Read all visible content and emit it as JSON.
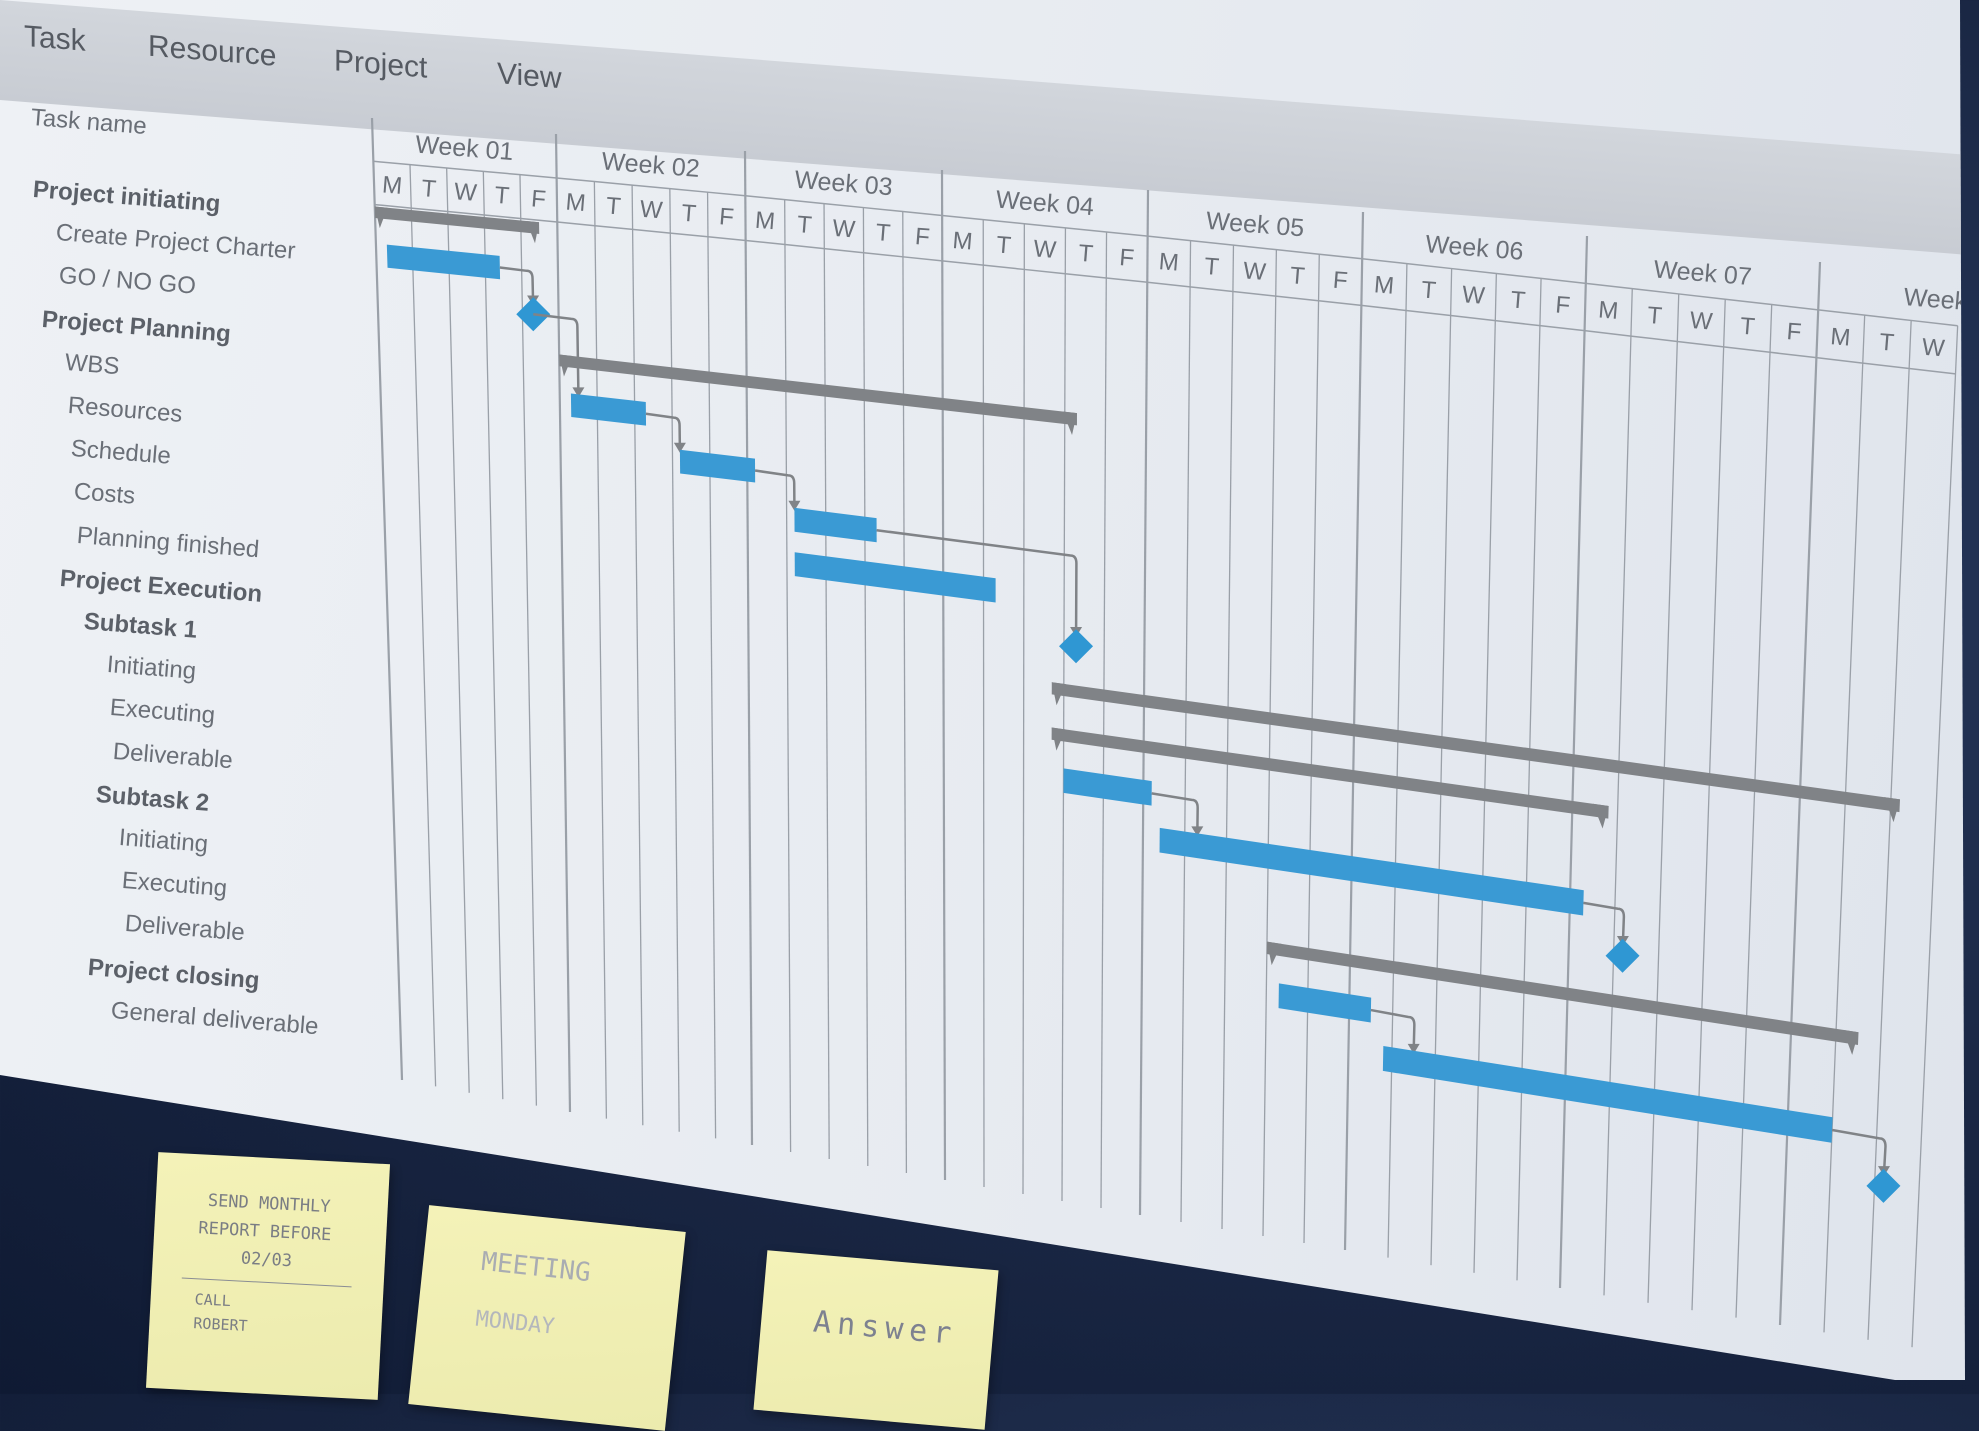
{
  "menu": {
    "items": [
      "Task",
      "Resource",
      "Project",
      "View"
    ]
  },
  "task_list": {
    "header": "Task name",
    "rows": [
      {
        "label": "Project initiating",
        "bold": true,
        "indent": 0
      },
      {
        "label": "Create Project Charter",
        "bold": false,
        "indent": 1
      },
      {
        "label": "GO / NO GO",
        "bold": false,
        "indent": 1
      },
      {
        "label": "Project Planning",
        "bold": true,
        "indent": 0
      },
      {
        "label": "WBS",
        "bold": false,
        "indent": 1
      },
      {
        "label": "Resources",
        "bold": false,
        "indent": 1
      },
      {
        "label": "Schedule",
        "bold": false,
        "indent": 1
      },
      {
        "label": "Costs",
        "bold": false,
        "indent": 1
      },
      {
        "label": "Planning finished",
        "bold": false,
        "indent": 1
      },
      {
        "label": "Project Execution",
        "bold": true,
        "indent": 0
      },
      {
        "label": "Subtask 1",
        "bold": true,
        "indent": 1
      },
      {
        "label": "Initiating",
        "bold": false,
        "indent": 2
      },
      {
        "label": "Executing",
        "bold": false,
        "indent": 2
      },
      {
        "label": "Deliverable",
        "bold": false,
        "indent": 2
      },
      {
        "label": "Subtask 2",
        "bold": true,
        "indent": 1
      },
      {
        "label": "Initiating",
        "bold": false,
        "indent": 2
      },
      {
        "label": "Executing",
        "bold": false,
        "indent": 2
      },
      {
        "label": "Deliverable",
        "bold": false,
        "indent": 2
      },
      {
        "label": "Project closing",
        "bold": true,
        "indent": 0
      },
      {
        "label": "General deliverable",
        "bold": false,
        "indent": 1
      }
    ]
  },
  "timeline": {
    "weeks": [
      "Week 01",
      "Week 02",
      "Week 03",
      "Week 04",
      "Week 05",
      "Week 06",
      "Week 07",
      "Week"
    ],
    "days": [
      "M",
      "T",
      "W",
      "T",
      "F"
    ],
    "visible_last_week_days": [
      "M",
      "T",
      "W"
    ]
  },
  "colors": {
    "task_bar": "#3a9ad4",
    "summary_bar": "#808387",
    "milestone": "#2f97d3",
    "grid": "#9aa0a8",
    "text": "#6a6f77"
  },
  "notes": [
    {
      "lines": [
        "SEND MONTHLY",
        "REPORT BEFORE",
        "02/03",
        "CALL",
        "ROBERT"
      ]
    },
    {
      "lines": [
        "MEETING",
        "MONDAY"
      ]
    },
    {
      "lines": [
        "Answer"
      ]
    }
  ]
}
